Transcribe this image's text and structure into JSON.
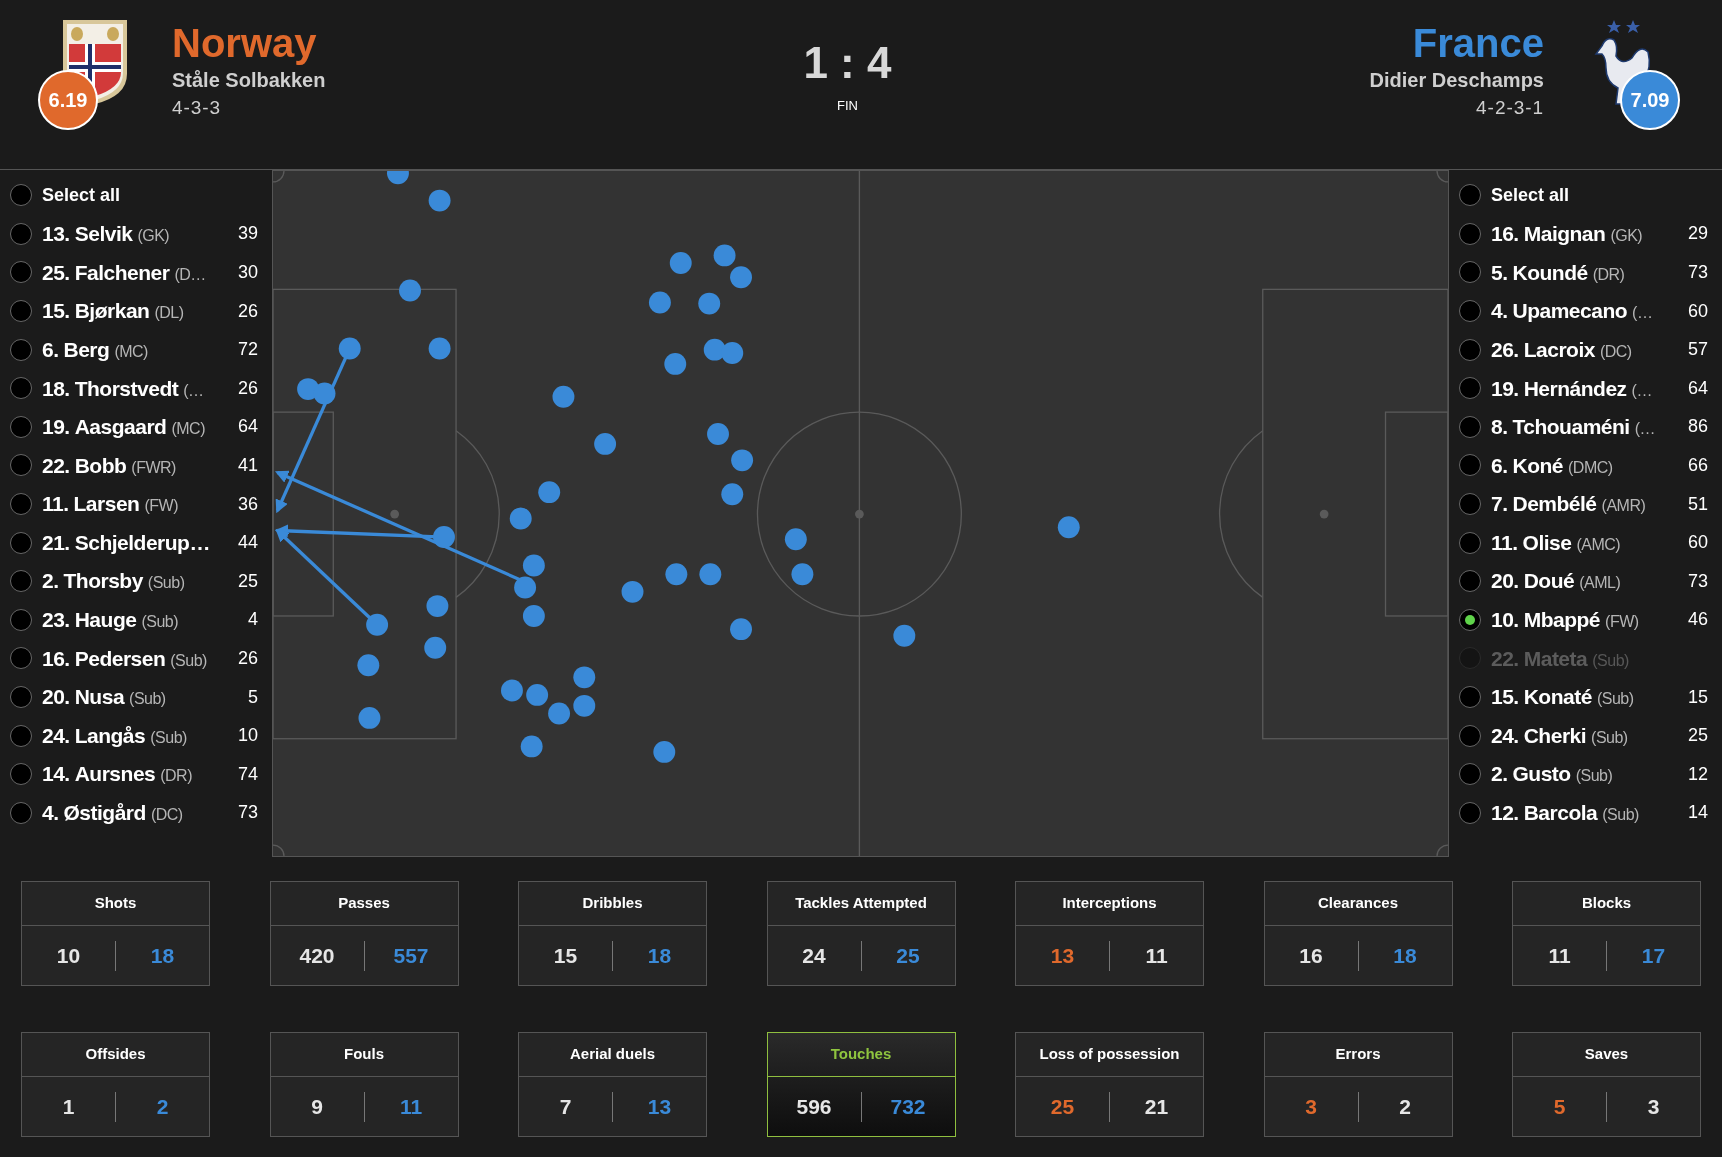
{
  "match": {
    "score": "1 : 4",
    "status": "FIN"
  },
  "home": {
    "name": "Norway",
    "coach": "Ståle Solbakken",
    "formation": "4-3-3",
    "rating": "6.19"
  },
  "away": {
    "name": "France",
    "coach": "Didier Deschamps",
    "formation": "4-2-3-1",
    "rating": "7.09"
  },
  "home_players": {
    "select_all": {
      "label": "Select all",
      "selected": false
    },
    "items": [
      {
        "number": "13.",
        "name": "Selvik",
        "position": "(GK)",
        "count": "39",
        "selected": false,
        "disabled": false
      },
      {
        "number": "25.",
        "name": "Falchener",
        "position": "(D…",
        "count": "30",
        "selected": false,
        "disabled": false
      },
      {
        "number": "15.",
        "name": "Bjørkan",
        "position": "(DL)",
        "count": "26",
        "selected": false,
        "disabled": false
      },
      {
        "number": "6.",
        "name": "Berg",
        "position": "(MC)",
        "count": "72",
        "selected": false,
        "disabled": false
      },
      {
        "number": "18.",
        "name": "Thorstvedt",
        "position": "(…",
        "count": "26",
        "selected": false,
        "disabled": false
      },
      {
        "number": "19.",
        "name": "Aasgaard",
        "position": "(MC)",
        "count": "64",
        "selected": false,
        "disabled": false
      },
      {
        "number": "22.",
        "name": "Bobb",
        "position": "(FWR)",
        "count": "41",
        "selected": false,
        "disabled": false
      },
      {
        "number": "11.",
        "name": "Larsen",
        "position": "(FW)",
        "count": "36",
        "selected": false,
        "disabled": false
      },
      {
        "number": "21.",
        "name": "Schjelderup…",
        "count": "44",
        "selected": false,
        "disabled": false
      },
      {
        "number": "2.",
        "name": "Thorsby",
        "position": "(Sub)",
        "count": "25",
        "selected": false,
        "disabled": false
      },
      {
        "number": "23.",
        "name": "Hauge",
        "position": "(Sub)",
        "count": "4",
        "selected": false,
        "disabled": false
      },
      {
        "number": "16.",
        "name": "Pedersen",
        "position": "(Sub)",
        "count": "26",
        "selected": false,
        "disabled": false
      },
      {
        "number": "20.",
        "name": "Nusa",
        "position": "(Sub)",
        "count": "5",
        "selected": false,
        "disabled": false
      },
      {
        "number": "24.",
        "name": "Langås",
        "position": "(Sub)",
        "count": "10",
        "selected": false,
        "disabled": false
      },
      {
        "number": "14.",
        "name": "Aursnes",
        "position": "(DR)",
        "count": "74",
        "selected": false,
        "disabled": false
      },
      {
        "number": "4.",
        "name": "Østigård",
        "position": "(DC)",
        "count": "73",
        "selected": false,
        "disabled": false
      }
    ]
  },
  "away_players": {
    "select_all": {
      "label": "Select all",
      "selected": false
    },
    "items": [
      {
        "number": "16.",
        "name": "Maignan",
        "position": "(GK)",
        "count": "29",
        "selected": false,
        "disabled": false
      },
      {
        "number": "5.",
        "name": "Koundé",
        "position": "(DR)",
        "count": "73",
        "selected": false,
        "disabled": false
      },
      {
        "number": "4.",
        "name": "Upamecano",
        "position": "(…",
        "count": "60",
        "selected": false,
        "disabled": false
      },
      {
        "number": "26.",
        "name": "Lacroix",
        "position": "(DC)",
        "count": "57",
        "selected": false,
        "disabled": false
      },
      {
        "number": "19.",
        "name": "Hernández",
        "position": "(…",
        "count": "64",
        "selected": false,
        "disabled": false
      },
      {
        "number": "8.",
        "name": "Tchouaméni",
        "position": "(…",
        "count": "86",
        "selected": false,
        "disabled": false
      },
      {
        "number": "6.",
        "name": "Koné",
        "position": "(DMC)",
        "count": "66",
        "selected": false,
        "disabled": false
      },
      {
        "number": "7.",
        "name": "Dembélé",
        "position": "(AMR)",
        "count": "51",
        "selected": false,
        "disabled": false
      },
      {
        "number": "11.",
        "name": "Olise",
        "position": "(AMC)",
        "count": "60",
        "selected": false,
        "disabled": false
      },
      {
        "number": "20.",
        "name": "Doué",
        "position": "(AML)",
        "count": "73",
        "selected": false,
        "disabled": false
      },
      {
        "number": "10.",
        "name": "Mbappé",
        "position": "(FW)",
        "count": "46",
        "selected": true,
        "disabled": false
      },
      {
        "number": "22.",
        "name": "Mateta",
        "position": "(Sub)",
        "selected": false,
        "disabled": true
      },
      {
        "number": "15.",
        "name": "Konaté",
        "position": "(Sub)",
        "count": "15",
        "selected": false,
        "disabled": false
      },
      {
        "number": "24.",
        "name": "Cherki",
        "position": "(Sub)",
        "count": "25",
        "selected": false,
        "disabled": false
      },
      {
        "number": "2.",
        "name": "Gusto",
        "position": "(Sub)",
        "count": "12",
        "selected": false,
        "disabled": false
      },
      {
        "number": "12.",
        "name": "Barcola",
        "position": "(Sub)",
        "count": "14",
        "selected": false,
        "disabled": false
      }
    ]
  },
  "stats": [
    [
      {
        "title": "Shots",
        "home": "10",
        "away": "18",
        "home_leads": false,
        "away_leads": true,
        "selected": false
      },
      {
        "title": "Passes",
        "home": "420",
        "away": "557",
        "home_leads": false,
        "away_leads": true,
        "selected": false
      },
      {
        "title": "Dribbles",
        "home": "15",
        "away": "18",
        "home_leads": false,
        "away_leads": true,
        "selected": false
      },
      {
        "title": "Tackles Attempted",
        "home": "24",
        "away": "25",
        "home_leads": false,
        "away_leads": true,
        "selected": false
      },
      {
        "title": "Interceptions",
        "home": "13",
        "away": "11",
        "home_leads": true,
        "away_leads": false,
        "selected": false
      },
      {
        "title": "Clearances",
        "home": "16",
        "away": "18",
        "home_leads": false,
        "away_leads": true,
        "selected": false
      },
      {
        "title": "Blocks",
        "home": "11",
        "away": "17",
        "home_leads": false,
        "away_leads": true,
        "selected": false
      }
    ],
    [
      {
        "title": "Offsides",
        "home": "1",
        "away": "2",
        "home_leads": false,
        "away_leads": true,
        "selected": false
      },
      {
        "title": "Fouls",
        "home": "9",
        "away": "11",
        "home_leads": false,
        "away_leads": true,
        "selected": false
      },
      {
        "title": "Aerial duels",
        "home": "7",
        "away": "13",
        "home_leads": false,
        "away_leads": true,
        "selected": false
      },
      {
        "title": "Touches",
        "home": "596",
        "away": "732",
        "home_leads": false,
        "away_leads": true,
        "selected": true
      },
      {
        "title": "Loss of possession",
        "home": "25",
        "away": "21",
        "home_leads": true,
        "away_leads": false,
        "selected": false
      },
      {
        "title": "Errors",
        "home": "3",
        "away": "2",
        "home_leads": true,
        "away_leads": false,
        "selected": false
      },
      {
        "title": "Saves",
        "home": "5",
        "away": "3",
        "home_leads": true,
        "away_leads": false,
        "selected": false
      }
    ]
  ]
}
